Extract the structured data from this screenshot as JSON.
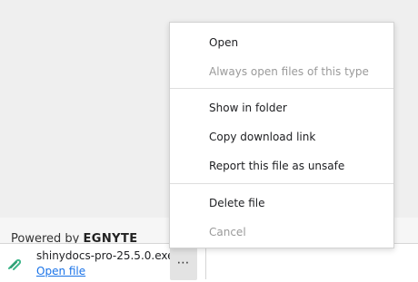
{
  "footer": {
    "powered_by": "Powered by",
    "brand": "EGNYTE"
  },
  "download": {
    "file_name": "shinydocs-pro-25.5.0.exe",
    "open_link": "Open file",
    "more_label": "⋯",
    "file_icon": "paperclip-icon",
    "icon_color": "#3fb68b"
  },
  "context_menu": {
    "open": "Open",
    "always_open": "Always open files of this type",
    "show_in_folder": "Show in folder",
    "copy_link": "Copy download link",
    "report_unsafe": "Report this file as unsafe",
    "delete": "Delete file",
    "cancel": "Cancel"
  }
}
